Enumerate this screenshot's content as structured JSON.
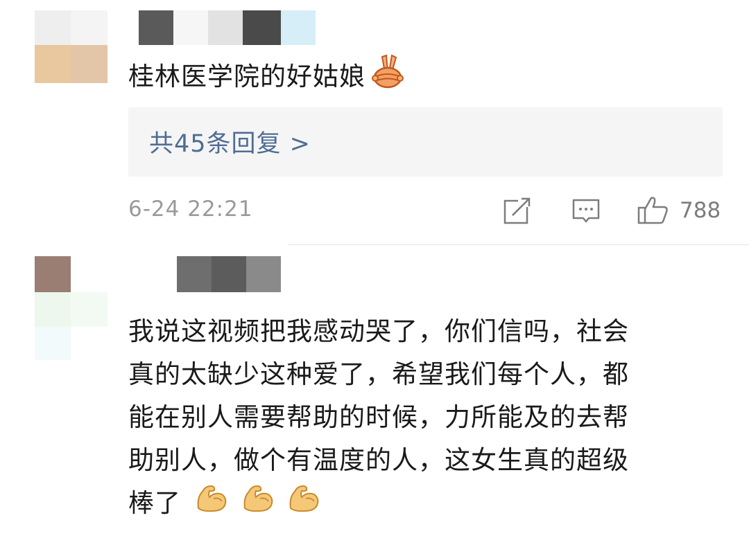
{
  "comment1": {
    "text": "桂林医学院的好姑娘",
    "reaction_icon": "victory-hand-emoji",
    "replies_label": "共45条回复 >",
    "timestamp": "6-24 22:21",
    "likes": "788",
    "actions": [
      "share-icon",
      "comment-icon",
      "like-icon"
    ]
  },
  "comment2": {
    "line1": "我说这视频把我感动哭了，你们信吗，社会",
    "line2": "真的太缺少这种爱了，希望我们每个人，都",
    "line3": "能在别人需要帮助的时候，力所能及的去帮",
    "line4": "助别人，做个有温度的人，这女生真的超级",
    "line5": "棒了",
    "reaction_icon": "flexed-biceps-emoji",
    "reaction_count": 3
  },
  "colors": {
    "text": "#1a1a1a",
    "link": "#4f6d93",
    "meta": "#9a9a9a",
    "reply_bg": "#f5f5f5"
  }
}
